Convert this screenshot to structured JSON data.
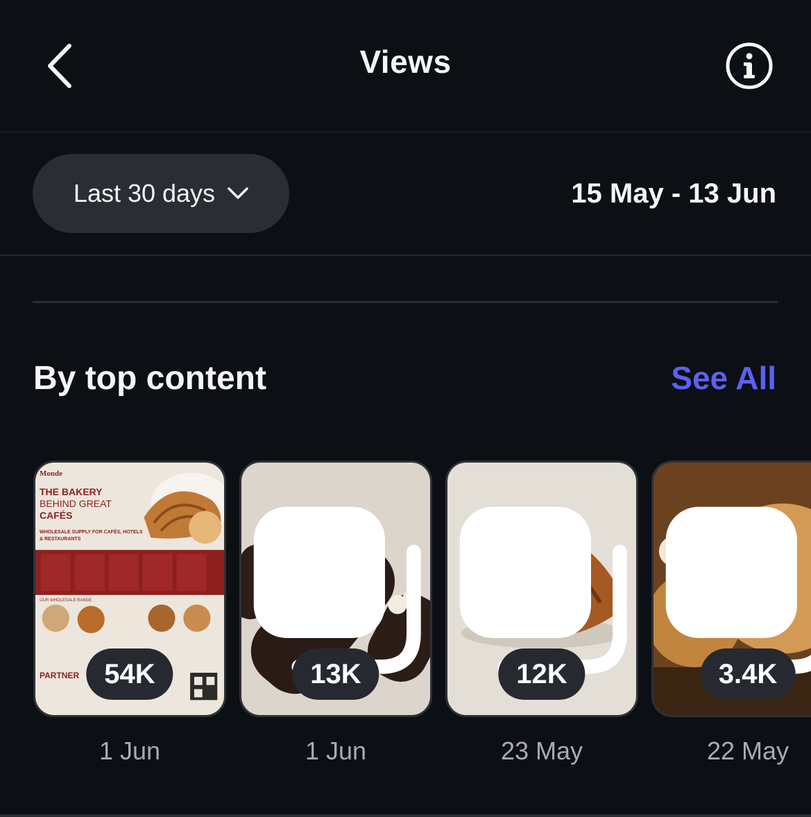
{
  "header": {
    "title": "Views",
    "back_icon": "chevron-left-icon",
    "info_icon": "info-icon"
  },
  "filter": {
    "range_label": "Last 30 days",
    "range_icon": "chevron-down-icon",
    "date_range": "15 May - 13 Jun"
  },
  "section": {
    "title": "By top content",
    "see_all": "See All"
  },
  "flyer": {
    "brand": "Monde",
    "heading1": "THE BAKERY",
    "heading2": "BEHIND GREAT",
    "heading3": "CAFÉS",
    "sub": "WHOLESALE SUPPLY FOR CAFÉS, HOTELS & RESTAURANTS",
    "range": "OUR WHOLESALE RANGE",
    "partner": "PARTNER"
  },
  "items": [
    {
      "views": "54K",
      "date": "1 Jun",
      "multi": false
    },
    {
      "views": "13K",
      "date": "1 Jun",
      "multi": true
    },
    {
      "views": "12K",
      "date": "23 May",
      "multi": true
    },
    {
      "views": "3.4K",
      "date": "22 May",
      "multi": true
    }
  ],
  "colors": {
    "background": "#0c0f14",
    "accent": "#5b61f0",
    "pill": "#2a2d33"
  }
}
